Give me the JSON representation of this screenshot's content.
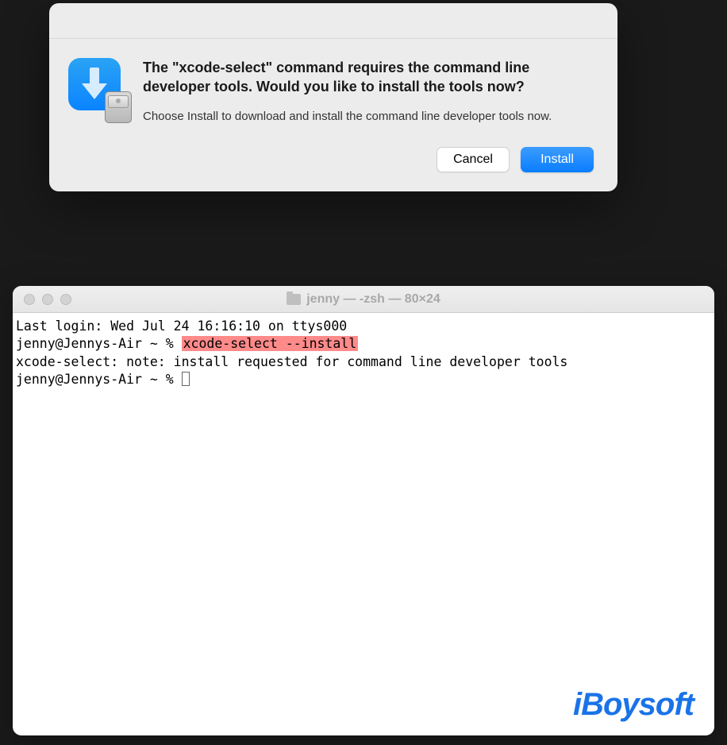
{
  "dialog": {
    "title": "The \"xcode-select\" command requires the command line developer tools. Would you like to install the tools now?",
    "description": "Choose Install to download and install the command line developer tools now.",
    "cancel_label": "Cancel",
    "install_label": "Install"
  },
  "terminal": {
    "window_title": "jenny — -zsh — 80×24",
    "lines": {
      "last_login": "Last login: Wed Jul 24 16:16:10 on ttys000",
      "prompt1_prefix": "jenny@Jennys-Air ~ % ",
      "command": "xcode-select --install",
      "note": "xcode-select: note: install requested for command line developer tools",
      "prompt2": "jenny@Jennys-Air ~ % "
    }
  },
  "watermark": "iBoysoft"
}
